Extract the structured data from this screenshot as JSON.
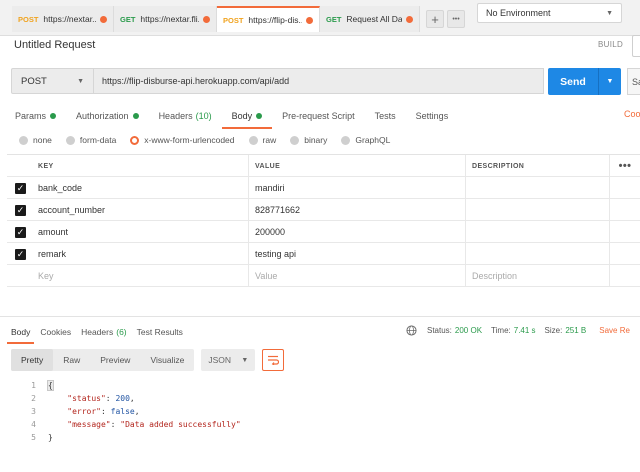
{
  "tabs": [
    {
      "method": "POST",
      "label": "https://nextar...",
      "dot": true
    },
    {
      "method": "GET",
      "label": "https://nextar.fli...",
      "dot": true
    },
    {
      "method": "POST",
      "label": "https://flip-dis...",
      "dot": true,
      "active": true
    },
    {
      "method": "GET",
      "label": "Request All Datas",
      "dot": true
    }
  ],
  "tabbar": {
    "add_label": "+",
    "more_label": "•••"
  },
  "environment": {
    "selected": "No Environment"
  },
  "request": {
    "title": "Untitled Request",
    "build_label": "BUILD",
    "method": "POST",
    "url": "https://flip-disburse-api.herokuapp.com/api/add",
    "send_label": "Send",
    "save_label": "Sa"
  },
  "request_tabs": {
    "params": "Params",
    "authorization": "Authorization",
    "headers": "Headers",
    "headers_count": "(10)",
    "body": "Body",
    "prerequest": "Pre-request Script",
    "tests": "Tests",
    "settings": "Settings",
    "cookies": "Coo"
  },
  "body_types": {
    "none": "none",
    "form_data": "form-data",
    "urlencoded": "x-www-form-urlencoded",
    "raw": "raw",
    "binary": "binary",
    "graphql": "GraphQL"
  },
  "kv_table": {
    "headers": {
      "key": "KEY",
      "value": "VALUE",
      "description": "DESCRIPTION",
      "more": "•••"
    },
    "rows": [
      {
        "key": "bank_code",
        "value": "mandiri",
        "checked": true
      },
      {
        "key": "account_number",
        "value": "828771662",
        "checked": true
      },
      {
        "key": "amount",
        "value": "200000",
        "checked": true
      },
      {
        "key": "remark",
        "value": "testing api",
        "checked": true
      }
    ],
    "placeholders": {
      "key": "Key",
      "value": "Value",
      "description": "Description"
    }
  },
  "response": {
    "tabs": {
      "body": "Body",
      "cookies": "Cookies",
      "headers": "Headers",
      "headers_count": "(6)",
      "test_results": "Test Results"
    },
    "status_label": "Status:",
    "status": "200 OK",
    "time_label": "Time:",
    "time": "7.41 s",
    "size_label": "Size:",
    "size": "251 B",
    "save_label": "Save Re",
    "formats": {
      "pretty": "Pretty",
      "raw": "Raw",
      "preview": "Preview",
      "visualize": "Visualize"
    },
    "language": "JSON",
    "code": {
      "line_numbers": [
        "1",
        "2",
        "3",
        "4",
        "5"
      ],
      "open_brace": "{",
      "close_brace": "}",
      "status_key": "\"status\"",
      "status_value": "200",
      "error_key": "\"error\"",
      "error_value": "false",
      "message_key": "\"message\"",
      "message_value": "\"Data added successfully\""
    }
  },
  "colors": {
    "accent": "#f26b3a",
    "send": "#1e88e5",
    "success": "#2a9a4b",
    "post": "#f0a31f",
    "get": "#2a9a4b"
  }
}
